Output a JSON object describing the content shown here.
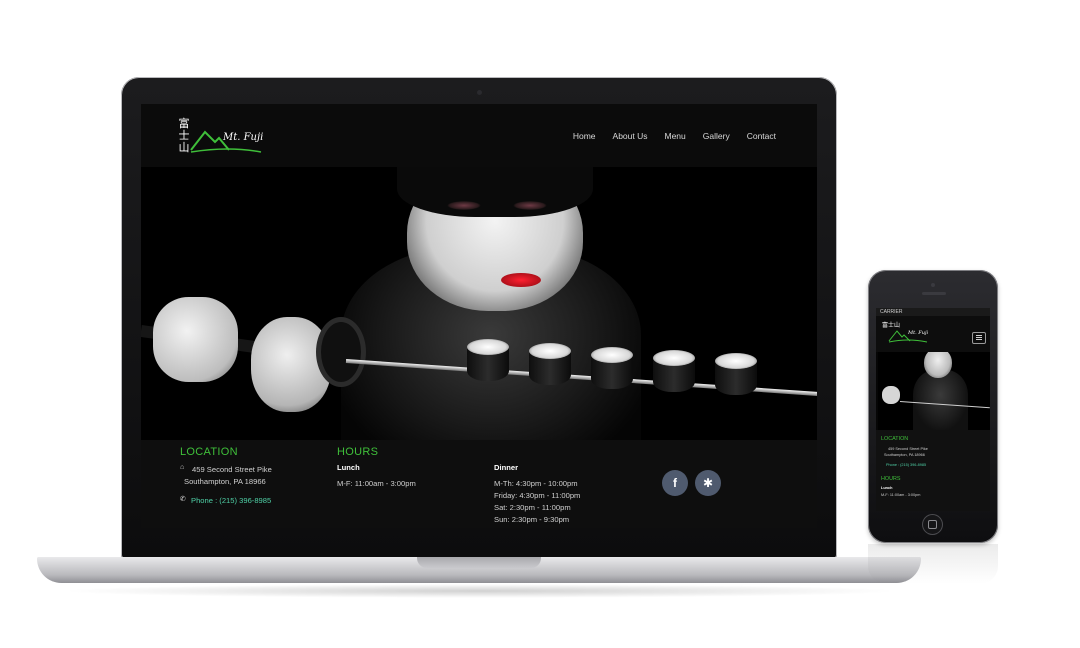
{
  "site": {
    "logo": {
      "kanji": "富士山",
      "text": "Mt. Fuji"
    },
    "nav": [
      "Home",
      "About Us",
      "Menu",
      "Gallery",
      "Contact"
    ]
  },
  "location": {
    "heading": "LOCATION",
    "street": "459 Second Street Pike",
    "city": "Southampton, PA 18966",
    "phone": "Phone : (215) 396-8985"
  },
  "hours": {
    "heading": "HOURS",
    "lunch": {
      "title": "Lunch",
      "lines": [
        "M-F: 11:00am - 3:00pm"
      ]
    },
    "dinner": {
      "title": "Dinner",
      "lines": [
        "M-Th: 4:30pm - 10:00pm",
        "Friday: 4:30pm - 11:00pm",
        "Sat: 2:30pm - 11:00pm",
        "Sun: 2:30pm - 9:30pm"
      ]
    }
  },
  "social": [
    {
      "icon": "facebook-icon",
      "glyph": "f"
    },
    {
      "icon": "yelp-icon",
      "glyph": "✱"
    }
  ],
  "phone": {
    "carrier": "CARRIER",
    "location_heading": "LOCATION",
    "street": "459 Second Street Pike",
    "city": "Southampton, PA 18966",
    "phone": "Phone : (215) 396-8985",
    "hours_heading": "HOURS",
    "lunch_title": "Lunch",
    "lunch_line": "M-F: 11:00am - 3:00pm"
  },
  "colors": {
    "accent_green": "#3fbf3a",
    "phone_link": "#4fd0a6",
    "social_bg": "#4f5a6e",
    "lips": "#ff2030"
  }
}
